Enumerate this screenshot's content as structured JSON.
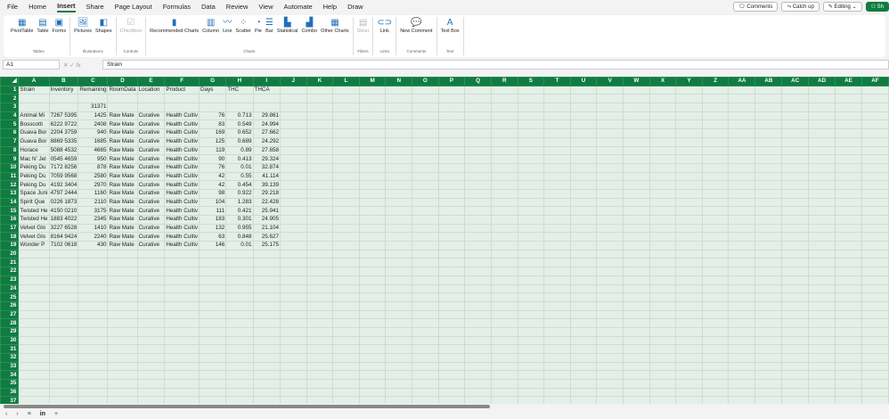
{
  "menu_tabs": [
    "File",
    "Home",
    "Insert",
    "Share",
    "Page Layout",
    "Formulas",
    "Data",
    "Review",
    "View",
    "Automate",
    "Help",
    "Draw"
  ],
  "active_tab": "Insert",
  "top_buttons": {
    "comments": "Comments",
    "catch_up": "Catch up",
    "editing": "Editing",
    "share": "Sh"
  },
  "ribbon": [
    {
      "group": "Tables",
      "items": [
        {
          "label": "PivotTable",
          "icon": "pivot-table-icon",
          "g": "▦"
        },
        {
          "label": "Table",
          "icon": "table-icon",
          "g": "▤"
        },
        {
          "label": "Forms",
          "icon": "forms-icon",
          "g": "▣"
        }
      ]
    },
    {
      "group": "Illustrations",
      "items": [
        {
          "label": "Pictures",
          "icon": "picture-icon",
          "g": "🖼"
        },
        {
          "label": "Shapes",
          "icon": "shapes-icon",
          "g": "◧"
        }
      ]
    },
    {
      "group": "Controls",
      "disabled": true,
      "items": [
        {
          "label": "Checkbox",
          "icon": "checkbox-icon",
          "g": "☑"
        }
      ]
    },
    {
      "group": "Charts",
      "items": [
        {
          "label": "Recommended Charts",
          "icon": "recommended-charts-icon",
          "g": "▮"
        },
        {
          "label": "Column",
          "icon": "column-chart-icon",
          "g": "▥"
        },
        {
          "label": "Line",
          "icon": "line-chart-icon",
          "g": "〰"
        },
        {
          "label": "Scatter",
          "icon": "scatter-chart-icon",
          "g": "⁘"
        },
        {
          "label": "Pie",
          "icon": "pie-chart-icon",
          "g": "◔"
        },
        {
          "label": "Bar",
          "icon": "bar-chart-icon",
          "g": "☰"
        },
        {
          "label": "Statistical",
          "icon": "statistical-chart-icon",
          "g": "▙"
        },
        {
          "label": "Combo",
          "icon": "combo-chart-icon",
          "g": "▟"
        },
        {
          "label": "Other Charts",
          "icon": "other-charts-icon",
          "g": "▦"
        }
      ]
    },
    {
      "group": "Filters",
      "disabled": true,
      "items": [
        {
          "label": "Slicer",
          "icon": "slicer-icon",
          "g": "▤"
        }
      ]
    },
    {
      "group": "Links",
      "items": [
        {
          "label": "Link",
          "icon": "link-icon",
          "g": "⊂⊃"
        }
      ]
    },
    {
      "group": "Comments",
      "items": [
        {
          "label": "New Comment",
          "icon": "new-comment-icon",
          "g": "💬"
        }
      ]
    },
    {
      "group": "Text",
      "items": [
        {
          "label": "Text Box",
          "icon": "text-box-icon",
          "g": "A"
        }
      ]
    }
  ],
  "name_box": "A1",
  "formula": "Strain",
  "columns": [
    "A",
    "B",
    "C",
    "D",
    "E",
    "F",
    "G",
    "H",
    "I",
    "J",
    "K",
    "L",
    "M",
    "N",
    "O",
    "P",
    "Q",
    "R",
    "S",
    "T",
    "U",
    "V",
    "W",
    "X",
    "Y",
    "Z",
    "AA",
    "AB",
    "AC",
    "AD",
    "AE",
    "AF"
  ],
  "row_count": 37,
  "rows": [
    [
      "Strain",
      "Inventory",
      "Remaining",
      "RoomData",
      "Location",
      "Product",
      "Days",
      "THC",
      "THCA"
    ],
    [],
    [
      "",
      "",
      "31371"
    ],
    [
      "Animal Mi",
      "7267 5395",
      "1425",
      "Raw Mate",
      "Curative",
      "Health Cultiv",
      "76",
      "0.713",
      "29.861"
    ],
    [
      "Bosscotti",
      "6222 9722",
      "2408",
      "Raw Mate",
      "Curative",
      "Health Cultiv",
      "83",
      "0.549",
      "24.994"
    ],
    [
      "Guava Bor",
      "2204 3759",
      "940",
      "Raw Mate",
      "Curative",
      "Health Cultiv",
      "169",
      "0.652",
      "27.662"
    ],
    [
      "Guava Bor",
      "8869 5335",
      "1685",
      "Raw Mate",
      "Curative",
      "Health Cultiv",
      "125",
      "0.689",
      "24.292"
    ],
    [
      "Horace",
      "5088 4532",
      "4665",
      "Raw Mate",
      "Curative",
      "Health Cultiv",
      "119",
      "0.89",
      "27.658"
    ],
    [
      "Mac N' Jel",
      "0545 4659",
      "950",
      "Raw Mate",
      "Curative",
      "Health Cultiv",
      "90",
      "0.413",
      "29.324"
    ],
    [
      "Peking Du",
      "7172 8256",
      "878",
      "Raw Mate",
      "Curative",
      "Health Cultiv",
      "76",
      "0.01",
      "32.874"
    ],
    [
      "Peking Du",
      "7059 9568",
      "2580",
      "Raw Mate",
      "Curative",
      "Health Cultiv",
      "42",
      "0.55",
      "41.114"
    ],
    [
      "Peking Du",
      "4192 3404",
      "2970",
      "Raw Mate",
      "Curative",
      "Health Cultiv",
      "42",
      "0.454",
      "39.139"
    ],
    [
      "Space Juni",
      "4797 2444",
      "1160",
      "Raw Mate",
      "Curative",
      "Health Cultiv",
      "98",
      "0.922",
      "29.218"
    ],
    [
      "Spirit Que",
      "0226 1873",
      "2110",
      "Raw Mate",
      "Curative",
      "Health Cultiv",
      "104",
      "1.283",
      "22.428"
    ],
    [
      "Twisted He",
      "4150 0210",
      "3175",
      "Raw Mate",
      "Curative",
      "Health Cultiv",
      "111",
      "0.421",
      "25.941"
    ],
    [
      "Twisted He",
      "1883 4022",
      "2345",
      "Raw Mate",
      "Curative",
      "Health Cultiv",
      "183",
      "0.301",
      "24.905"
    ],
    [
      "Velvet Glo",
      "3227 6528",
      "1410",
      "Raw Mate",
      "Curative",
      "Health Cultiv",
      "132",
      "0.955",
      "21.104"
    ],
    [
      "Velvet Glo",
      "8164 9424",
      "2240",
      "Raw Mate",
      "Curative",
      "Health Cultiv",
      "63",
      "0.848",
      "25.627"
    ],
    [
      "Wonder P",
      "7102 0618",
      "430",
      "Raw Mate",
      "Curative",
      "Health Cultiv",
      "146",
      "0.01",
      "25.175"
    ]
  ],
  "sheet_bar": {
    "prev": "‹",
    "next": "›",
    "menu": "≡",
    "sheet": "in",
    "add": "+"
  }
}
